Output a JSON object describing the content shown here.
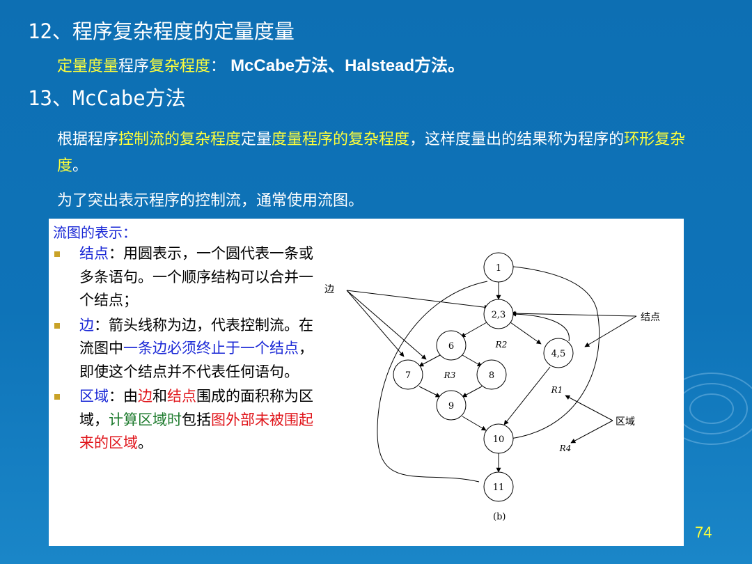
{
  "heading1": "12、程序复杂程度的定量度量",
  "line1": {
    "term1": "定量度量",
    "text1": "程序",
    "term2": "复杂程度",
    "colon": "：",
    "methods": "McCabe方法、Halstead方法。"
  },
  "heading2": "13、McCabe方法",
  "para1": {
    "p1": "根据程序",
    "p2": "控制流的复杂程度",
    "p3": "定量",
    "p4": "度量程序的复杂程度",
    "p5": "，这样度量出的结果称为程序的",
    "p6": "环形复杂度",
    "p7": "。"
  },
  "para2": "为了突出表示程序的控制流，通常使用流图。",
  "panel": {
    "title": "流图的表示：",
    "bullet1": {
      "label": "结点",
      "text": "：用圆表示，一个圆代表一条或多条语句。一个顺序结构可以合并一个结点；"
    },
    "bullet2": {
      "label": "边",
      "text1": "：箭头线称为边，代表控制流。在流图中",
      "blue": "一条边必须终止于一个结点",
      "text2": "，即使这个结点并不代表任何语句。"
    },
    "bullet3": {
      "label": "区域",
      "t1": "：由",
      "edge": "边",
      "t2": "和",
      "node": "结点",
      "t3": "围成的面积称为区域，",
      "green": "计算区域时",
      "t4": "包括",
      "red": "图外部未被围起来的区域",
      "t5": "。"
    }
  },
  "diagram": {
    "nodes": [
      "1",
      "2,3",
      "6",
      "4,5",
      "7",
      "8",
      "9",
      "10",
      "11"
    ],
    "annotations": {
      "edge": "边",
      "node": "结点",
      "region": "区域",
      "caption": "(b)"
    },
    "regions": [
      "R2",
      "R3",
      "R1",
      "R4"
    ]
  },
  "page_number": "74"
}
